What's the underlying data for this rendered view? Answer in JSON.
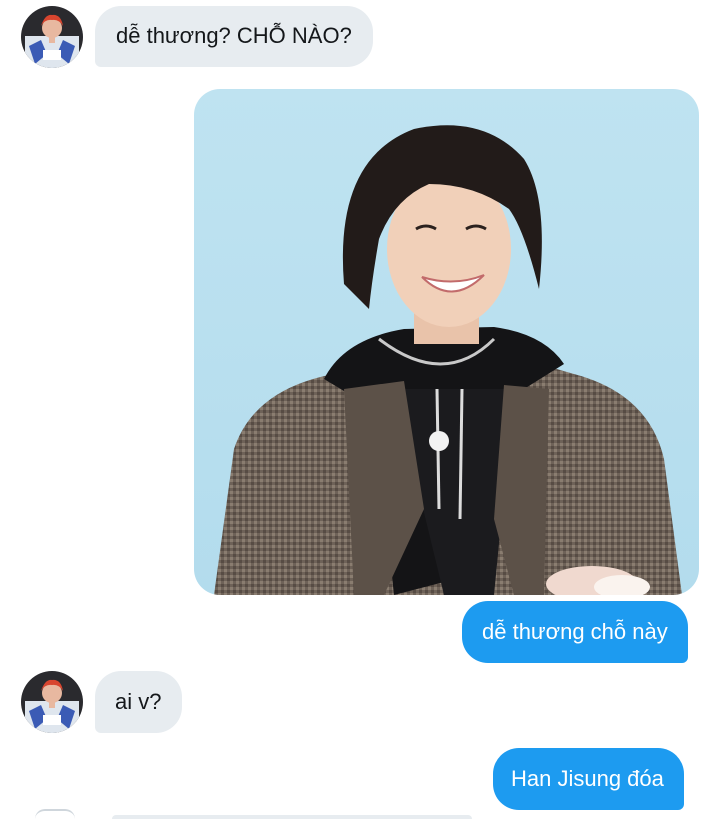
{
  "messages": [
    {
      "direction": "incoming",
      "type": "text",
      "text": "dễ thương? CHỖ NÀO?"
    },
    {
      "direction": "outgoing",
      "type": "photo",
      "photo_subject": "smiling young man in a brown checked blazer over a black hoodie"
    },
    {
      "direction": "outgoing",
      "type": "text",
      "text": "dễ thương chỗ này"
    },
    {
      "direction": "incoming",
      "type": "text",
      "text": "ai v?"
    },
    {
      "direction": "outgoing",
      "type": "text",
      "text": "Han Jisung đóa"
    }
  ],
  "colors": {
    "incoming_bubble": "#e7ecf0",
    "outgoing_bubble": "#1d9bf0",
    "photo_background": "#bfe3f1"
  },
  "icons": {
    "contact_avatar": "avatar"
  }
}
